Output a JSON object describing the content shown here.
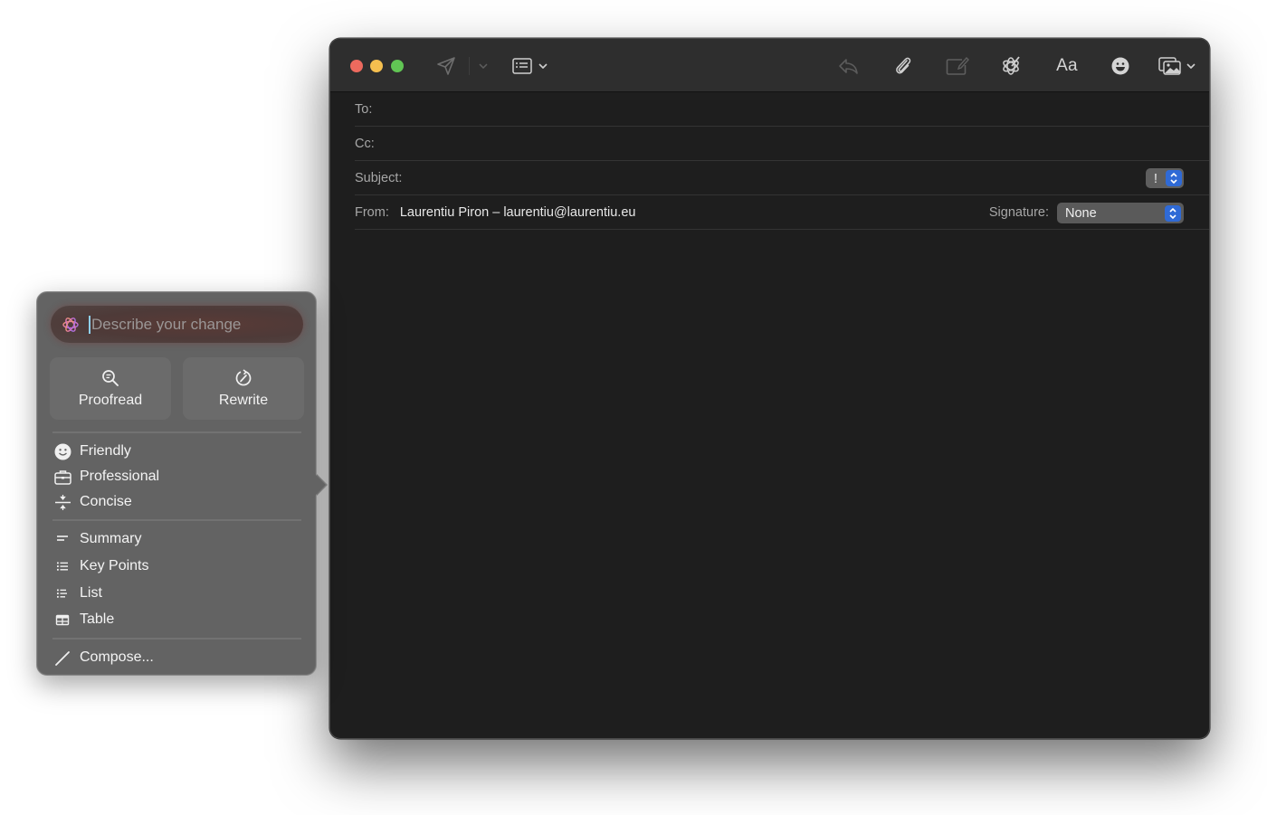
{
  "window": {
    "toolbar": {
      "icons": [
        "send-icon",
        "send-options-chevron-icon",
        "header-fields-icon",
        "reply-icon",
        "attachment-icon",
        "markup-icon",
        "writing-tools-icon",
        "format-icon",
        "emoji-icon",
        "photo-browser-icon"
      ],
      "format_label": "Aa"
    },
    "fields": {
      "to_label": "To:",
      "cc_label": "Cc:",
      "subject_label": "Subject:",
      "priority_symbol": "!",
      "from_label": "From:",
      "from_value": "Laurentiu Piron – laurentiu@laurentiu.eu",
      "signature_label": "Signature:",
      "signature_value": "None"
    }
  },
  "writing_tools": {
    "prompt_placeholder": "Describe your change",
    "actions": [
      {
        "label": "Proofread",
        "icon": "magnifier-text-icon"
      },
      {
        "label": "Rewrite",
        "icon": "rewrite-arrow-icon"
      }
    ],
    "tone_items": [
      {
        "label": "Friendly",
        "icon": "smiley-icon"
      },
      {
        "label": "Professional",
        "icon": "briefcase-icon"
      },
      {
        "label": "Concise",
        "icon": "divide-icon"
      }
    ],
    "format_items": [
      {
        "label": "Summary",
        "icon": "summary-lines-icon"
      },
      {
        "label": "Key Points",
        "icon": "bulleted-list-icon"
      },
      {
        "label": "List",
        "icon": "list-icon"
      },
      {
        "label": "Table",
        "icon": "table-icon"
      }
    ],
    "compose_label": "Compose..."
  },
  "colors": {
    "accent_blue": "#2f6ad6",
    "close": "#ed6a5e",
    "minimize": "#f5bf4f",
    "zoom": "#61c554"
  }
}
